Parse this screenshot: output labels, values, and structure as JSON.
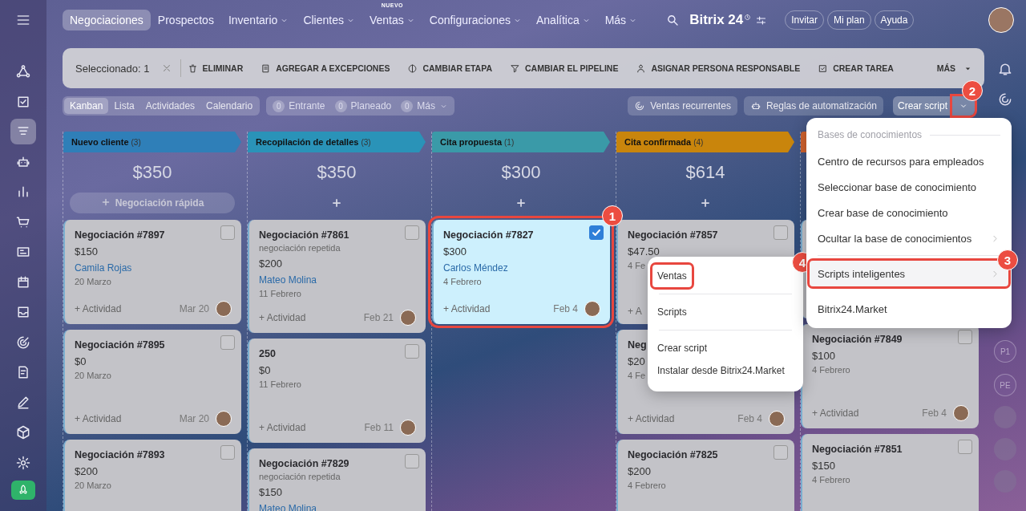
{
  "sidebar": {
    "items": [
      {
        "kind": "network",
        "selected": false
      },
      {
        "kind": "tasks",
        "selected": false
      },
      {
        "kind": "crm",
        "selected": true
      },
      {
        "kind": "robot",
        "selected": false
      },
      {
        "kind": "chart",
        "selected": false
      },
      {
        "kind": "cart",
        "selected": false
      },
      {
        "kind": "card",
        "selected": false
      },
      {
        "kind": "calendar",
        "selected": false
      },
      {
        "kind": "inbox",
        "selected": false
      },
      {
        "kind": "target",
        "selected": false
      },
      {
        "kind": "docedit",
        "selected": false
      },
      {
        "kind": "pen",
        "selected": false
      },
      {
        "kind": "cube",
        "selected": false
      },
      {
        "kind": "gear",
        "selected": false
      }
    ]
  },
  "nav": {
    "items": [
      {
        "label": "Negociaciones",
        "selected": true,
        "dropdown": false
      },
      {
        "label": "Prospectos",
        "selected": false,
        "dropdown": false
      },
      {
        "label": "Inventario",
        "selected": false,
        "dropdown": true
      },
      {
        "label": "Clientes",
        "selected": false,
        "dropdown": true
      },
      {
        "label": "Ventas",
        "selected": false,
        "dropdown": true,
        "badge": "NUEVO"
      },
      {
        "label": "Configuraciones",
        "selected": false,
        "dropdown": true
      },
      {
        "label": "Analítica",
        "selected": false,
        "dropdown": true
      },
      {
        "label": "Más",
        "selected": false,
        "dropdown": true
      }
    ]
  },
  "brand": {
    "name": "Bitrix 24"
  },
  "header_buttons": [
    "Invitar",
    "Mi plan",
    "Ayuda"
  ],
  "toolbar": {
    "selection": "Seleccionado: 1",
    "actions": [
      "ELIMINAR",
      "AGREGAR A EXCEPCIONES",
      "CAMBIAR ETAPA",
      "CAMBIAR EL PIPELINE",
      "ASIGNAR PERSONA RESPONSABLE",
      "CREAR TAREA"
    ],
    "more": "MÁS"
  },
  "views": [
    {
      "label": "Kanban",
      "selected": true
    },
    {
      "label": "Lista",
      "selected": false
    },
    {
      "label": "Actividades",
      "selected": false
    },
    {
      "label": "Calendario",
      "selected": false
    }
  ],
  "counters": [
    {
      "count": "0",
      "label": "Entrante",
      "dropdown": false
    },
    {
      "count": "0",
      "label": "Planeado",
      "dropdown": false
    },
    {
      "count": "0",
      "label": "Más",
      "dropdown": true
    }
  ],
  "right_buttons": [
    "Ventas recurrentes",
    "Reglas de automatización"
  ],
  "script_button": {
    "label": "Crear script",
    "highlighted": true,
    "callout": "2"
  },
  "columns": [
    {
      "title": "Nuevo cliente",
      "count": "(3)",
      "color": "#2f7fb8",
      "total": "$350",
      "add": "Negociación rápida",
      "cards": [
        {
          "kind": "deal",
          "title": "Negociación #7897",
          "amount": "$150",
          "contact": "Camila Rojas",
          "date": "20 Marzo",
          "activity": "+ Actividad",
          "due": "Mar 20",
          "checked": false,
          "selected": false
        },
        {
          "kind": "deal",
          "title": "Negociación #7895",
          "amount": "$0",
          "date": "20 Marzo",
          "activity": "+ Actividad",
          "due": "Mar 20",
          "checked": false,
          "selected": false
        },
        {
          "kind": "deal",
          "title": "Negociación #7893",
          "amount": "$200",
          "date": "20 Marzo",
          "checked": false,
          "selected": false
        }
      ]
    },
    {
      "title": "Recopilación de detalles",
      "count": "(3)",
      "color": "#2a93b8",
      "total": "$350",
      "cards": [
        {
          "kind": "deal",
          "title": "Negociación #7861",
          "subtitle": "negociación repetida",
          "amount": "$200",
          "contact": "Mateo Molina",
          "date": "11 Febrero",
          "activity": "+ Actividad",
          "due": "Feb 21",
          "checked": false,
          "selected": false
        },
        {
          "kind": "deal",
          "title": "250",
          "amount": "$0",
          "date": "11 Febrero",
          "activity": "+ Actividad",
          "due": "Feb 11",
          "checked": false,
          "selected": false
        },
        {
          "kind": "deal",
          "title": "Negociación #7829",
          "subtitle": "negociación repetida",
          "amount": "$150",
          "contact": "Mateo Molina",
          "checked": false,
          "selected": false
        }
      ]
    },
    {
      "title": "Cita propuesta",
      "count": "(1)",
      "color": "#3a9aa8",
      "total": "$300",
      "cards": [
        {
          "kind": "deal",
          "title": "Negociación #7827",
          "amount": "$300",
          "contact": "Carlos Méndez",
          "date": "4 Febrero",
          "activity": "+ Actividad",
          "due": "Feb 4",
          "checked": true,
          "selected": true,
          "callout": "1"
        }
      ]
    },
    {
      "title": "Cita confirmada",
      "count": "(4)",
      "color": "#c9850c",
      "total": "$614",
      "cards": [
        {
          "kind": "deal",
          "title": "Negociación #7857",
          "amount": "$47.50",
          "date": "4 Fe",
          "activity": "+ A",
          "checked": false,
          "selected": false
        },
        {
          "kind": "deal",
          "title": "Neg",
          "amount": "$20",
          "date": "4 Fe",
          "activity": "+ Actividad",
          "due": "Feb 4",
          "selected": false
        },
        {
          "kind": "deal",
          "title": "Negociación #7825",
          "amount": "$200",
          "date": "4 Febrero",
          "checked": false,
          "selected": false
        }
      ]
    },
    {
      "color": "#d0622e",
      "cards": [
        {
          "kind": "covered"
        },
        {
          "kind": "deal",
          "title": "Negociación #7849",
          "amount": "$100",
          "date": "4 Febrero",
          "activity": "+ Actividad",
          "due": "Feb 4",
          "checked": false,
          "selected": false
        },
        {
          "kind": "deal",
          "title": "Negociación #7851",
          "amount": "$150",
          "date": "4 Febrero",
          "checked": false,
          "selected": false
        }
      ]
    }
  ],
  "rail": {
    "initials": [
      "P1",
      "PE"
    ]
  },
  "menu": {
    "section": "Bases de conocimientos",
    "items": [
      {
        "kind": "item",
        "label": "Centro de recursos para empleados",
        "submenu": false,
        "highlighted": false
      },
      {
        "kind": "item",
        "label": "Seleccionar base de conocimiento",
        "submenu": false,
        "highlighted": false
      },
      {
        "kind": "item",
        "label": "Crear base de conocimiento",
        "submenu": false,
        "highlighted": false
      },
      {
        "kind": "item",
        "label": "Ocultar la base de conocimientos",
        "submenu": true,
        "highlighted": false
      },
      {
        "kind": "divider"
      },
      {
        "kind": "item",
        "label": "Scripts inteligentes",
        "submenu": true,
        "highlighted": true,
        "callout": "3"
      },
      {
        "kind": "item",
        "label": "Bitrix24.Market",
        "submenu": false,
        "highlighted": false
      }
    ]
  },
  "submenu": {
    "items": [
      {
        "kind": "item",
        "label": "Ventas",
        "highlighted": true,
        "callout": "4"
      },
      {
        "kind": "divider"
      },
      {
        "kind": "item",
        "label": "Scripts",
        "highlighted": false
      },
      {
        "kind": "divider"
      },
      {
        "kind": "item",
        "label": "Crear script",
        "highlighted": false
      },
      {
        "kind": "item",
        "label": "Instalar desde Bitrix24.Market",
        "highlighted": false
      }
    ]
  }
}
